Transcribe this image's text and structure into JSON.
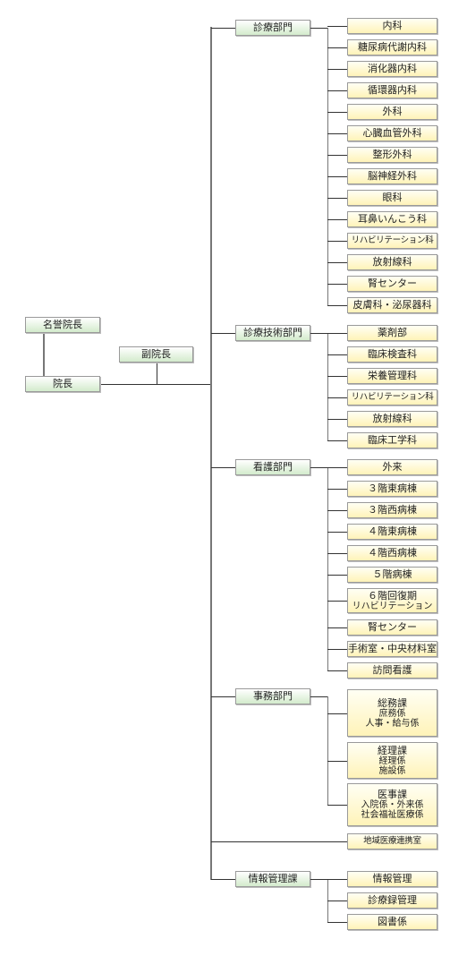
{
  "chart": {
    "root": {
      "honorary_director": "名誉院長",
      "director": "院長",
      "vice_director": "副院長"
    },
    "departments": [
      {
        "name": "診療部門",
        "children": [
          {
            "lines": [
              "内科"
            ]
          },
          {
            "lines": [
              "糖尿病代謝内科"
            ]
          },
          {
            "lines": [
              "消化器内科"
            ]
          },
          {
            "lines": [
              "循環器内科"
            ]
          },
          {
            "lines": [
              "外科"
            ]
          },
          {
            "lines": [
              "心臓血管外科"
            ]
          },
          {
            "lines": [
              "整形外科"
            ]
          },
          {
            "lines": [
              "脳神経外科"
            ]
          },
          {
            "lines": [
              "眼科"
            ]
          },
          {
            "lines": [
              "耳鼻いんこう科"
            ]
          },
          {
            "lines": [
              "リハビリテーション科"
            ]
          },
          {
            "lines": [
              "放射線科"
            ]
          },
          {
            "lines": [
              "腎センター"
            ]
          },
          {
            "lines": [
              "皮膚科・泌尿器科"
            ]
          }
        ]
      },
      {
        "name": "診療技術部門",
        "children": [
          {
            "lines": [
              "薬剤部"
            ]
          },
          {
            "lines": [
              "臨床検査科"
            ]
          },
          {
            "lines": [
              "栄養管理科"
            ]
          },
          {
            "lines": [
              "リハビリテーション科"
            ]
          },
          {
            "lines": [
              "放射線科"
            ]
          },
          {
            "lines": [
              "臨床工学科"
            ]
          }
        ]
      },
      {
        "name": "看護部門",
        "children": [
          {
            "lines": [
              "外来"
            ]
          },
          {
            "lines": [
              "３階東病棟"
            ]
          },
          {
            "lines": [
              "３階西病棟"
            ]
          },
          {
            "lines": [
              "４階東病棟"
            ]
          },
          {
            "lines": [
              "４階西病棟"
            ]
          },
          {
            "lines": [
              "５階病棟"
            ]
          },
          {
            "lines": [
              "６階回復期",
              "リハビリテーション"
            ]
          },
          {
            "lines": [
              "腎センター"
            ]
          },
          {
            "lines": [
              "手術室・中央材料室"
            ]
          },
          {
            "lines": [
              "訪問看護"
            ]
          }
        ]
      },
      {
        "name": "事務部門",
        "children": [
          {
            "lines": [
              "総務課",
              "庶務係",
              "人事・給与係"
            ]
          },
          {
            "lines": [
              "経理課",
              "経理係",
              "施設係"
            ]
          },
          {
            "lines": [
              "医事課",
              "入院係・外来係",
              "社会福祉医療係"
            ]
          }
        ]
      },
      {
        "name": "情報管理課",
        "children": [
          {
            "lines": [
              "情報管理"
            ]
          },
          {
            "lines": [
              "診療録管理"
            ]
          },
          {
            "lines": [
              "図書係"
            ]
          }
        ]
      }
    ],
    "standalone_units": [
      {
        "name": "地域医療連携室"
      }
    ]
  }
}
